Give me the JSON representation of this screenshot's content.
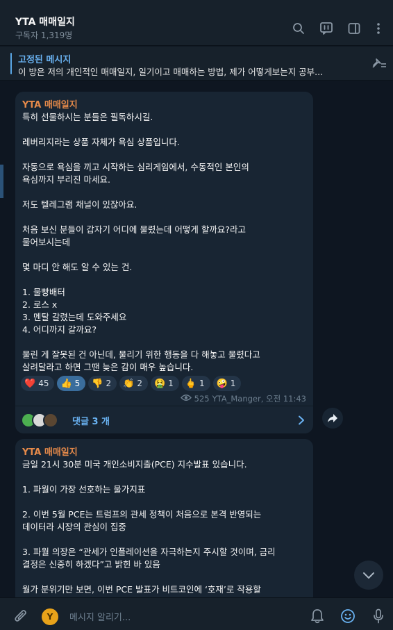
{
  "header": {
    "title": "YTA 매매일지",
    "subtitle": "구독자 1,319명"
  },
  "pinned": {
    "title": "고정된 메시지",
    "text": "이 방은 저의 개인적인 매매일지, 일기이고 매매하는 방법, 제가 어떻게보는지 공부..."
  },
  "messages": [
    {
      "sender": "YTA 매매일지",
      "text": "특히 선물하시는 분들은 필독하시길.\n\n레버리지라는 상품 자체가 욕심 상품입니다.\n\n자동으로 욕심을 끼고 시작하는 심리게임에서, 수동적인 본인의\n욕심까지 부리진 마세요.\n\n저도 텔레그램 채널이 있잖아요.\n\n처음 보신 분들이 갑자기 어디에 물렸는데 어떻게 할까요?라고\n물어보시는데\n\n몇 마디 안 해도 알 수 있는 건.\n\n1. 물빵배터\n2. 로스 x\n3. 멘탈 갈렸는데 도와주세요\n4. 어디까지 갈까요?\n\n물린 게 잘못된 건 아닌데, 물리기 위한 행동을 다 해놓고 물렸다고\n살려달라고 하면 그땐 늦은 감이 매우 높습니다.",
      "reactions": [
        {
          "emoji": "❤️",
          "count": "45"
        },
        {
          "emoji": "👍",
          "count": "5"
        },
        {
          "emoji": "👎",
          "count": "2"
        },
        {
          "emoji": "👏",
          "count": "2"
        },
        {
          "emoji": "🤮",
          "count": "1"
        },
        {
          "emoji": "🖕",
          "count": "1"
        },
        {
          "emoji": "🤪",
          "count": "1"
        }
      ],
      "views": "525",
      "author": "YTA_Manger, 오전 11:43",
      "comments_label": "댓글 3 개"
    },
    {
      "sender": "YTA 매매일지",
      "text": "금일 21시 30분 미국 개인소비지출(PCE) 지수발표 있습니다.\n\n1. 파월이 가장 선호하는 물가지표\n\n2. 이번 5월 PCE는 트럼프의 관세 정책이 처음으로 본격 반영되는\n데이터라 시장의 관심이 집중\n\n3. 파월 의장은 “관세가 인플레이션을 자극하는지 주시할 것이며, 금리\n결정은 신중히 하겠다”고 밝힌 바 있음\n\n월가 분위기만 보면, 이번 PCE 발표가 비트코인에 ‘호재’로 작용할\n가능성이 높아 보이는 데, 금요일 저녁 중간리 라이가 전에 참고하시면"
    }
  ],
  "composer": {
    "placeholder": "메시지 알리기...",
    "sendas_initial": "Y"
  },
  "colors": {
    "background": "#0e1621",
    "panel": "#17212b",
    "bubble": "#182533",
    "accent": "#6ab3f3",
    "sender": "#e68a4a"
  },
  "icons": [
    "search-icon",
    "live-chat-icon",
    "sidebar-toggle-icon",
    "more-icon",
    "unpin-list-icon",
    "eye-icon",
    "chevron-right-icon",
    "share-icon",
    "chevron-down-icon",
    "attach-icon",
    "bell-icon",
    "emoji-icon",
    "microphone-icon"
  ]
}
